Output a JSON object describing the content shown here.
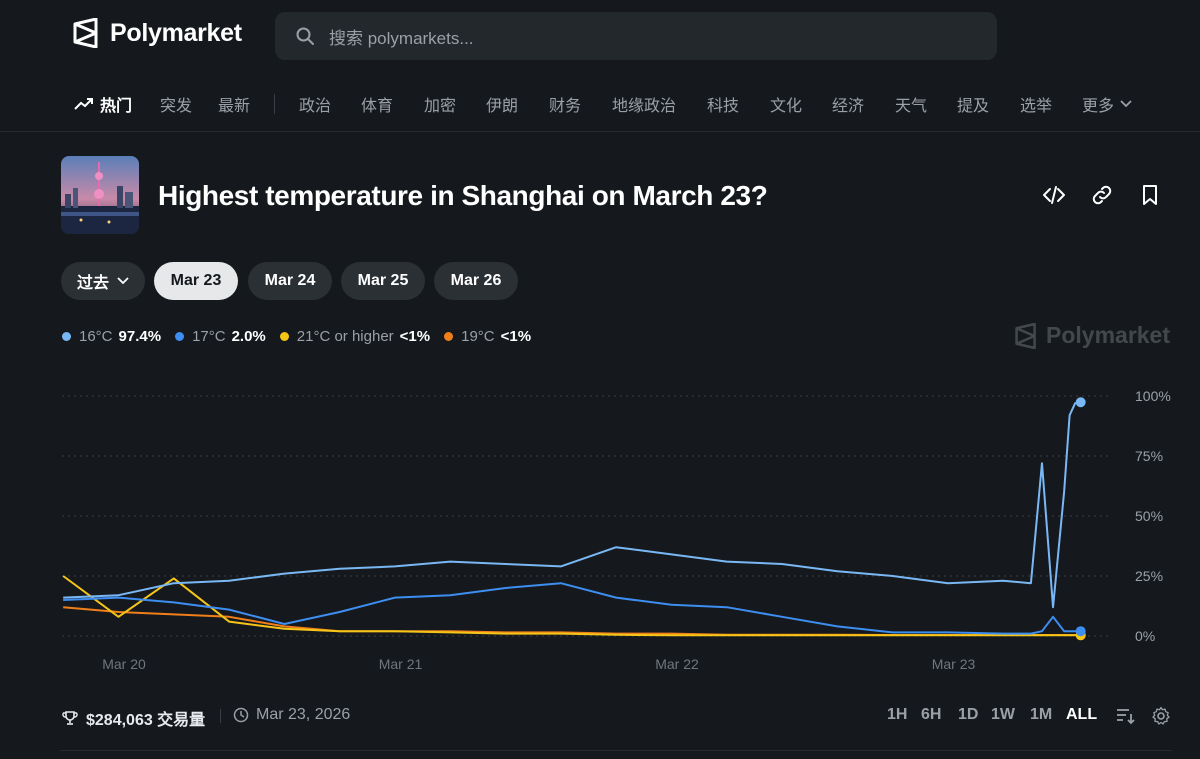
{
  "brand": {
    "name": "Polymarket"
  },
  "search": {
    "placeholder": "搜索 polymarkets..."
  },
  "nav": {
    "items": [
      {
        "label": "热门",
        "active": true
      },
      {
        "label": "突发"
      },
      {
        "label": "最新"
      },
      {
        "label": "政治"
      },
      {
        "label": "体育"
      },
      {
        "label": "加密"
      },
      {
        "label": "伊朗"
      },
      {
        "label": "财务"
      },
      {
        "label": "地缘政治"
      },
      {
        "label": "科技"
      },
      {
        "label": "文化"
      },
      {
        "label": "经济"
      },
      {
        "label": "天气"
      },
      {
        "label": "提及"
      },
      {
        "label": "选举"
      },
      {
        "label": "更多"
      }
    ]
  },
  "market": {
    "title": "Highest temperature in Shanghai on March 23?",
    "actions": [
      "embed-icon",
      "link-icon",
      "bookmark-icon"
    ]
  },
  "date_tabs": [
    {
      "label": "过去",
      "dropdown": true
    },
    {
      "label": "Mar 23",
      "selected": true
    },
    {
      "label": "Mar 24"
    },
    {
      "label": "Mar 25"
    },
    {
      "label": "Mar 26"
    }
  ],
  "legend": [
    {
      "name": "16°C",
      "value": "97.4%",
      "color": "#7ab8f5"
    },
    {
      "name": "17°C",
      "value": "2.0%",
      "color": "#3d8ef0"
    },
    {
      "name": "21°C or higher",
      "value": "<1%",
      "color": "#f5c518"
    },
    {
      "name": "19°C",
      "value": "<1%",
      "color": "#f07f1a"
    }
  ],
  "chart_data": {
    "type": "line",
    "x_ticks": [
      "Mar 20",
      "Mar 21",
      "Mar 22",
      "Mar 23"
    ],
    "y_ticks": [
      "100%",
      "75%",
      "50%",
      "25%",
      "0%"
    ],
    "ylim": [
      0,
      100
    ],
    "x": [
      0,
      0.2,
      0.4,
      0.6,
      0.8,
      1.0,
      1.2,
      1.4,
      1.6,
      1.8,
      2.0,
      2.2,
      2.4,
      2.6,
      2.8,
      3.0,
      3.2,
      3.4,
      3.5,
      3.54,
      3.58,
      3.62,
      3.64,
      3.66,
      3.68
    ],
    "series": [
      {
        "name": "16°C",
        "color": "#7ab8f5",
        "values": [
          16,
          17,
          22,
          23,
          26,
          28,
          29,
          31,
          30,
          29,
          37,
          34,
          31,
          30,
          27,
          25,
          22,
          23,
          22,
          72,
          12,
          60,
          92,
          97,
          97.4
        ]
      },
      {
        "name": "17°C",
        "color": "#3d8ef0",
        "values": [
          15,
          16,
          14,
          11,
          5,
          10,
          16,
          17,
          20,
          22,
          16,
          13,
          12,
          8,
          4,
          1.5,
          1.5,
          1,
          1,
          2,
          8,
          2,
          2,
          2,
          2.0
        ]
      },
      {
        "name": "21°C or higher",
        "color": "#f5c518",
        "values": [
          25,
          8,
          24,
          6,
          3,
          2,
          2,
          1.5,
          1,
          1,
          0.5,
          0.3,
          0.3,
          0.3,
          0.3,
          0.3,
          0.3,
          0.3,
          0.3,
          0.3,
          0.3,
          0.3,
          0.3,
          0.3,
          0.3
        ]
      },
      {
        "name": "19°C",
        "color": "#f07f1a",
        "values": [
          12,
          10,
          9,
          8,
          4,
          2,
          2,
          2,
          1.5,
          1.5,
          1,
          1,
          0.5,
          0.5,
          0.5,
          0.4,
          0.4,
          0.4,
          0.4,
          0.4,
          0.4,
          0.4,
          0.4,
          0.4,
          0.4
        ]
      }
    ],
    "grid": true
  },
  "footer": {
    "volume": "$284,063 交易量",
    "date": "Mar 23, 2026",
    "ranges": [
      "1H",
      "6H",
      "1D",
      "1W",
      "1M",
      "ALL"
    ],
    "active_range": "ALL"
  }
}
